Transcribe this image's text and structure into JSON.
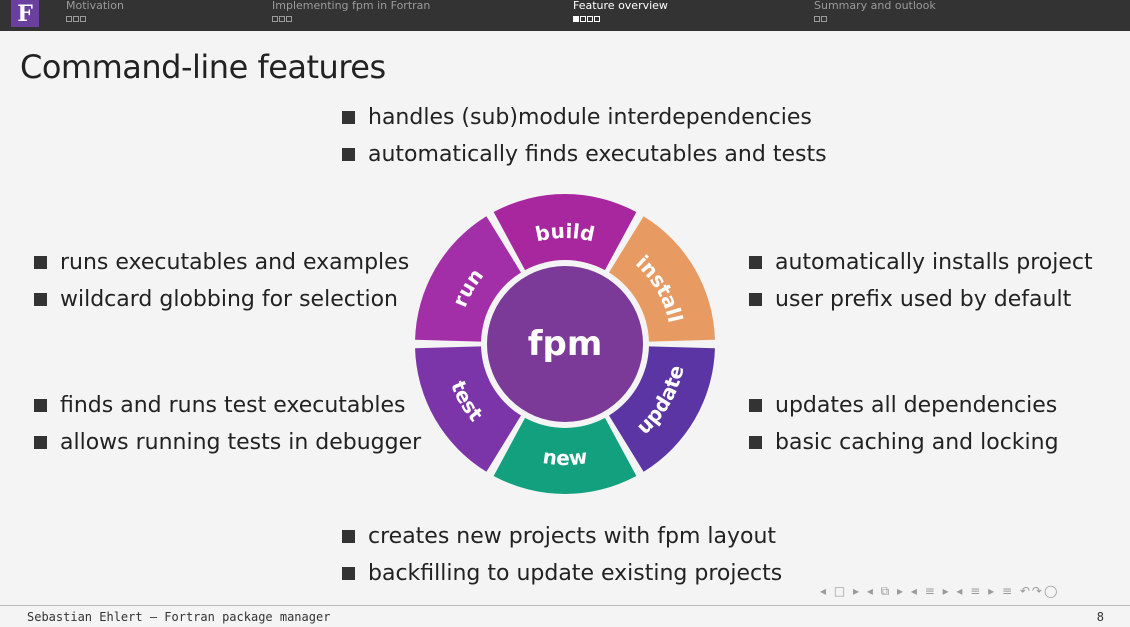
{
  "header": {
    "logo_letter": "F",
    "sections": [
      {
        "label": "Motivation"
      },
      {
        "label": "Implementing fpm in Fortran"
      },
      {
        "label": "Feature overview"
      },
      {
        "label": "Summary and outlook"
      }
    ]
  },
  "slide": {
    "title": "Command-line features",
    "top_bullets": [
      "handles (sub)module interdependencies",
      "automatically finds executables and tests"
    ],
    "left_top_bullets": [
      "runs executables and examples",
      "wildcard globbing for selection"
    ],
    "left_bottom_bullets": [
      "finds and runs test executables",
      "allows running tests in debugger"
    ],
    "right_top_bullets": [
      "automatically installs project",
      "user prefix used by default"
    ],
    "right_bottom_bullets": [
      "updates all dependencies",
      "basic caching and locking"
    ],
    "bottom_bullets": [
      "creates new projects with fpm layout",
      "backfilling to update existing projects"
    ]
  },
  "wheel": {
    "center_label": "fpm",
    "center_color": "#7b3a98",
    "segments": [
      {
        "label": "build",
        "color": "#a8279e"
      },
      {
        "label": "install",
        "color": "#e79b63"
      },
      {
        "label": "update",
        "color": "#5a35a3"
      },
      {
        "label": "new",
        "color": "#13a07e"
      },
      {
        "label": "test",
        "color": "#7b35a8"
      },
      {
        "label": "run",
        "color": "#a22fa8"
      }
    ]
  },
  "footer": {
    "author": "Sebastian Ehlert – Fortran package manager",
    "page": "8",
    "nav_controls": "◂ □ ▸ ◂ ⧉ ▸ ◂ ≡ ▸ ◂ ≡ ▸   ≡   ↶↷◯"
  }
}
